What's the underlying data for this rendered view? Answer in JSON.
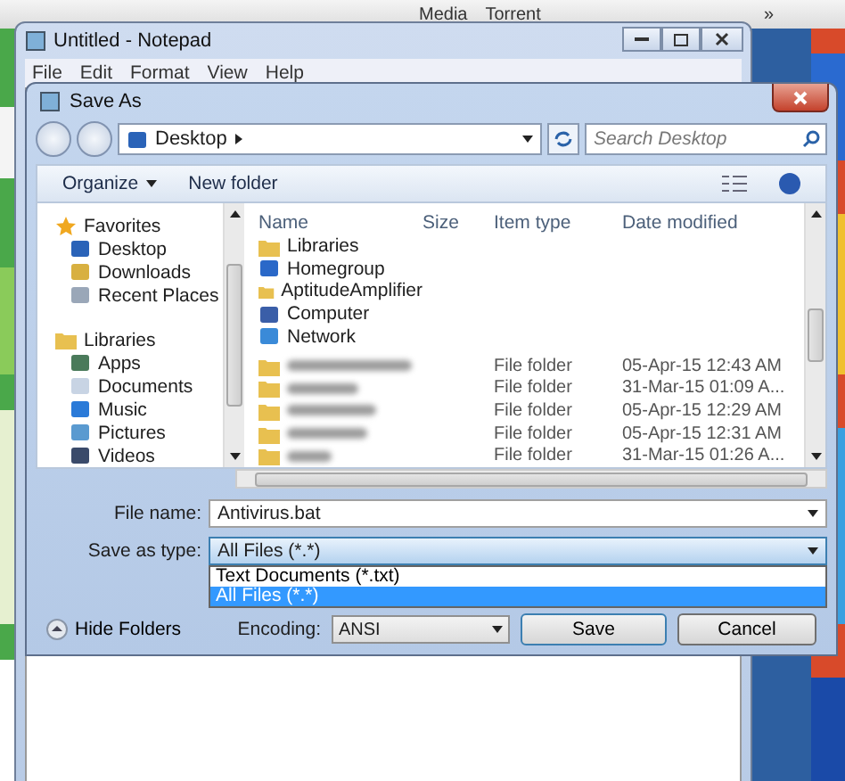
{
  "browser_toolbar": {
    "items": [
      "Media",
      "Torrent"
    ],
    "overflow": "»"
  },
  "notepad": {
    "title": "Untitled - Notepad",
    "menu": [
      "File",
      "Edit",
      "Format",
      "View",
      "Help"
    ]
  },
  "dialog": {
    "title": "Save As",
    "address": "Desktop",
    "search": {
      "placeholder": "Search Desktop"
    },
    "toolbar": [
      "Organize",
      "New folder"
    ],
    "nav": [
      {
        "label": "Favorites",
        "children": [
          {
            "label": "Desktop"
          },
          {
            "label": "Downloads"
          },
          {
            "label": "Recent Places"
          }
        ]
      },
      {
        "label": "Libraries",
        "children": [
          {
            "label": "Apps"
          },
          {
            "label": "Documents"
          },
          {
            "label": "Music"
          },
          {
            "label": "Pictures"
          },
          {
            "label": "Videos"
          }
        ]
      }
    ],
    "columns": [
      "Name",
      "Size",
      "Item type",
      "Date modified"
    ],
    "rows": [
      {
        "kind": "item",
        "name": "Libraries"
      },
      {
        "kind": "item",
        "name": "Homegroup"
      },
      {
        "kind": "item",
        "name": "AptitudeAmplifier"
      },
      {
        "kind": "item",
        "name": "Computer"
      },
      {
        "kind": "item",
        "name": "Network"
      },
      {
        "kind": "blurred",
        "type": "File folder",
        "date": "05-Apr-15 12:43 AM"
      },
      {
        "kind": "blurred",
        "type": "File folder",
        "date": "31-Mar-15 01:09 A..."
      },
      {
        "kind": "blurred",
        "type": "File folder",
        "date": "05-Apr-15 12:29 AM"
      },
      {
        "kind": "blurred",
        "type": "File folder",
        "date": "05-Apr-15 12:31 AM"
      },
      {
        "kind": "blurred",
        "type": "File folder",
        "date": "31-Mar-15 01:26 A..."
      }
    ],
    "file_name": {
      "label": "File name:",
      "value": "Antivirus.bat"
    },
    "save_as_type": {
      "label": "Save as type:",
      "value": "All Files  (*.*)",
      "expanded": true,
      "options": [
        {
          "label": "Text Documents (*.txt)",
          "selected": false
        },
        {
          "label": "All Files  (*.*)",
          "selected": true
        }
      ]
    },
    "hide_folders": "Hide Folders",
    "encoding": {
      "label": "Encoding:",
      "value": "ANSI"
    },
    "buttons": [
      "Save",
      "Cancel"
    ]
  }
}
